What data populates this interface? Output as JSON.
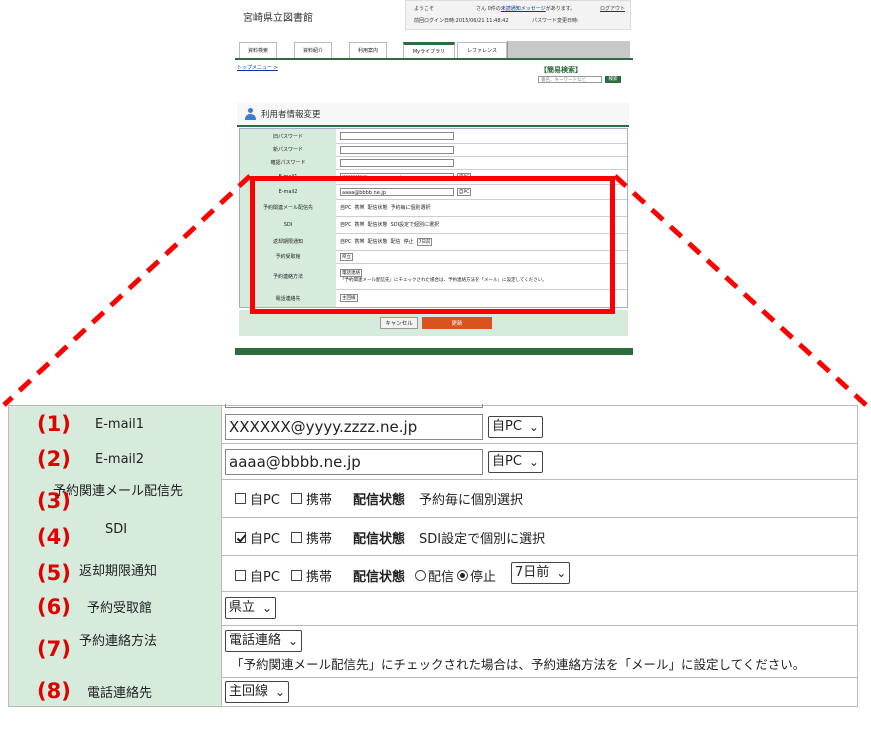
{
  "thumb": {
    "library_title": "宮崎県立図書館",
    "welcome": "ようこそ",
    "unread_msg_prefix": "さん 0件の",
    "unread_msg_link": "未読通知メッセージ",
    "unread_msg_suffix": "があります。",
    "logout": "ログアウト",
    "last_login": "前回ログイン日時:2015/06/21 11:48:42",
    "password_changed": "パスワード変更日時:",
    "tabs": [
      "資料検索",
      "資料紹介",
      "利用案内",
      "Myライブラリ",
      "レファレンス"
    ],
    "breadcrumb": "トップメニュー >",
    "simple_search_title": "【簡易検索】",
    "keyword_placeholder": "書名、キーワードなど",
    "search_button": "検索",
    "section_title": "利用者情報変更",
    "rows": {
      "old_password": "旧パスワード",
      "new_password": "新パスワード",
      "confirm_password": "確認パスワード",
      "email1": "E-mail1",
      "email2": "E-mail2",
      "reserve_mail": "予約関連メール配信先",
      "sdi": "SDI",
      "return_notice": "返却期限通知",
      "pickup_library": "予約受取館",
      "contact_method": "予約連絡方法",
      "phone_contact": "電話連絡先"
    },
    "email1_value": "XXXXXX@yyyy.zzzz.ne.jp",
    "email2_value": "aaaa@bbbb.ne.jp",
    "pc_option": "自PC",
    "cancel_button": "キャンセル",
    "update_button": "更新"
  },
  "zoom": {
    "rows": [
      {
        "num": "(1)",
        "label": "E-mail1"
      },
      {
        "num": "(2)",
        "label": "E-mail2"
      },
      {
        "num": "(3)",
        "label": "予約関連メール配信先"
      },
      {
        "num": "(4)",
        "label": "SDI"
      },
      {
        "num": "(5)",
        "label": "返却期限通知"
      },
      {
        "num": "(6)",
        "label": "予約受取館"
      },
      {
        "num": "(7)",
        "label": "予約連絡方法"
      },
      {
        "num": "(8)",
        "label": "電話連絡先"
      }
    ],
    "email1_value": "XXXXXX@yyyy.zzzz.ne.jp",
    "email2_value": "aaaa@bbbb.ne.jp",
    "device_select": "自PC",
    "own_pc": "自PC",
    "mobile": "携帯",
    "delivery_status": "配信状態",
    "reserve_status_text": "予約毎に個別選択",
    "sdi_status_text": "SDI設定で個別に選択",
    "deliver": "配信",
    "stop": "停止",
    "days_before": "7日前",
    "pickup_value": "県立",
    "contact_value": "電話連絡",
    "contact_note": "「予約関連メール配信先」にチェックされた場合は、予約連絡方法を「メール」に設定してください。",
    "phone_value": "主回線",
    "chevron_icon": "chevron-down-icon"
  },
  "colors": {
    "label_bg": "#d7ebdd",
    "brand_green": "#2e6b3e",
    "highlight_red": "#ff0000",
    "number_red": "#e00000",
    "update_orange": "#d9531e"
  }
}
